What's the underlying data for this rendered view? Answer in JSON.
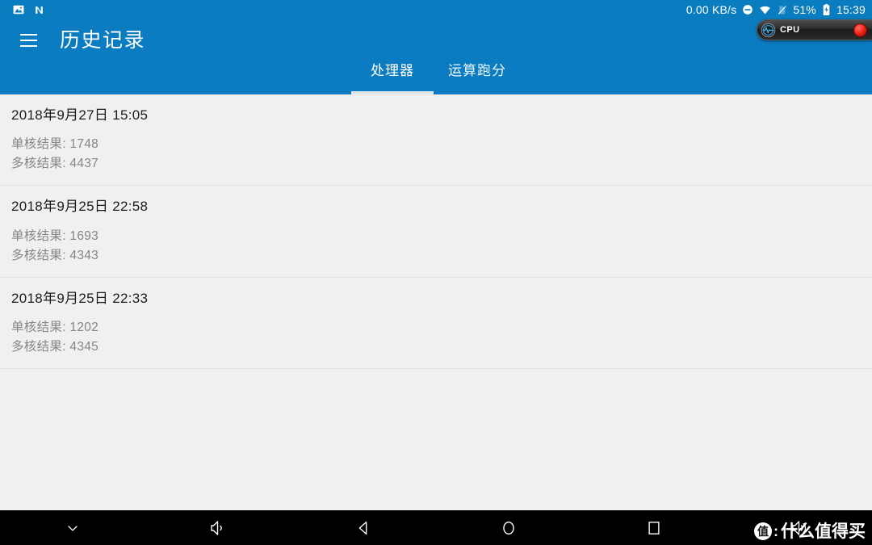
{
  "status_bar": {
    "left_icons": [
      "screenshot-icon",
      "nfc-icon"
    ],
    "network_speed": "0.00 KB/s",
    "dnd_icon": "do-not-disturb-icon",
    "wifi_icon": "wifi-icon",
    "signal_icon": "no-sim-icon",
    "battery_percent": "51%",
    "battery_icon": "battery-charging-icon",
    "clock": "15:39",
    "background_color": "#0a7dc1"
  },
  "cpu_widget": {
    "icon": "pulse-gauge-icon",
    "label": "CPU",
    "record_button": "record-button",
    "accent_color": "#e81f12"
  },
  "app_bar": {
    "menu_icon": "hamburger-menu-icon",
    "title": "历史记录",
    "background_color": "#0b7cc1",
    "tabs": [
      {
        "label": "处理器",
        "active": true
      },
      {
        "label": "运算跑分",
        "active": false
      }
    ]
  },
  "history": {
    "labels": {
      "single_core": "单核结果:",
      "multi_core": "多核结果:"
    },
    "items": [
      {
        "date": "2018年9月27日 15:05",
        "single_core": "单核结果: 1748",
        "multi_core": "多核结果: 4437",
        "single_core_value": 1748,
        "multi_core_value": 4437
      },
      {
        "date": "2018年9月25日 22:58",
        "single_core": "单核结果: 1693",
        "multi_core": "多核结果: 4343",
        "single_core_value": 1693,
        "multi_core_value": 4343
      },
      {
        "date": "2018年9月25日 22:33",
        "single_core": "单核结果: 1202",
        "multi_core": "多核结果: 4345",
        "single_core_value": 1202,
        "multi_core_value": 4345
      }
    ]
  },
  "nav_bar": {
    "buttons": [
      {
        "icon": "chevron-down-icon"
      },
      {
        "icon": "volume-down-icon"
      },
      {
        "icon": "back-icon"
      },
      {
        "icon": "home-icon"
      },
      {
        "icon": "recents-icon"
      },
      {
        "icon": "volume-up-icon"
      }
    ],
    "background_color": "#000000"
  },
  "watermark": {
    "badge": "值",
    "colon": ":",
    "text": "什么值得买"
  }
}
